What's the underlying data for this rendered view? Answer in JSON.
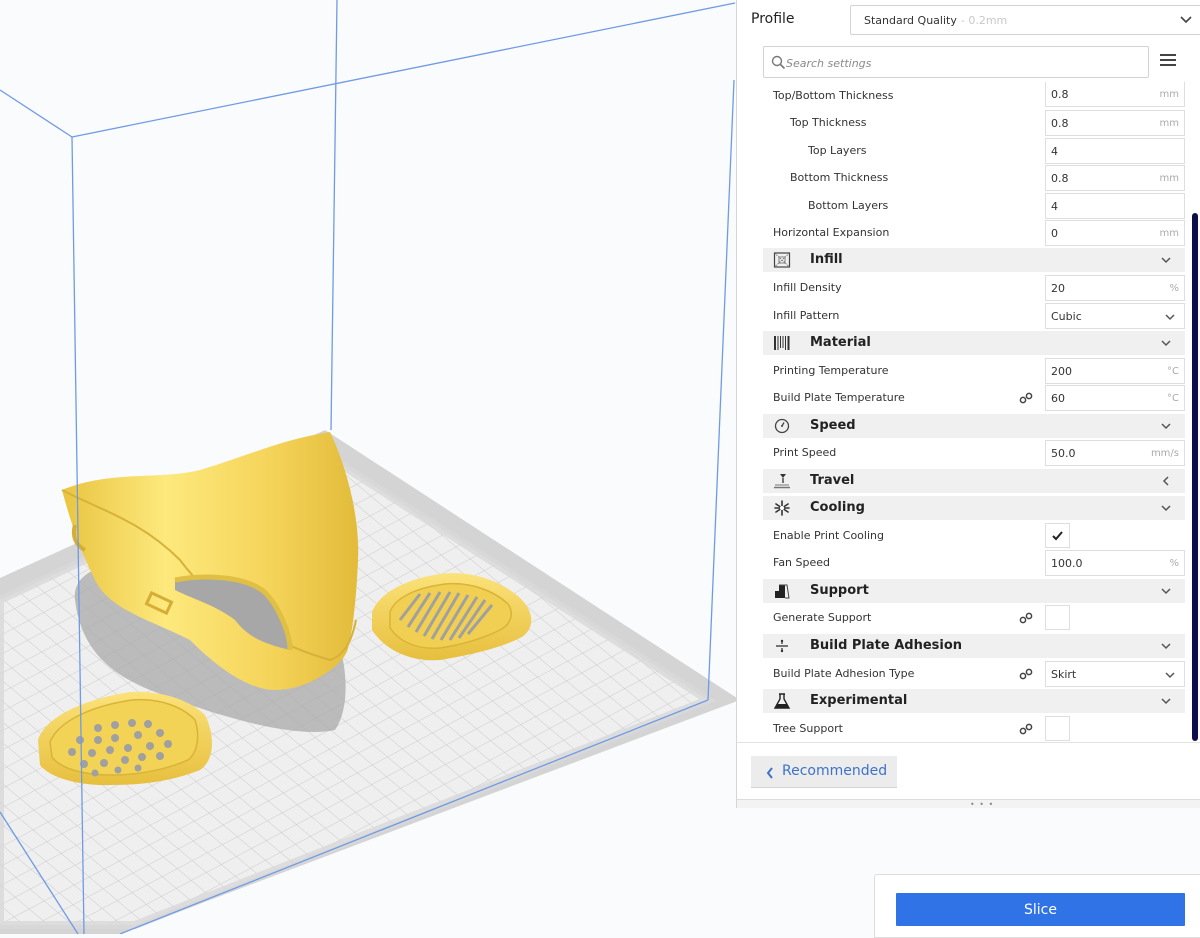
{
  "profile": {
    "label": "Profile",
    "value": "Standard Quality",
    "suffix": "- 0.2mm"
  },
  "search": {
    "placeholder": "Search settings"
  },
  "settings": {
    "top_bottom_thickness": {
      "label": "Top/Bottom Thickness",
      "value": "0.8",
      "unit": "mm"
    },
    "top_thickness": {
      "label": "Top Thickness",
      "value": "0.8",
      "unit": "mm"
    },
    "top_layers": {
      "label": "Top Layers",
      "value": "4"
    },
    "bottom_thickness": {
      "label": "Bottom Thickness",
      "value": "0.8",
      "unit": "mm"
    },
    "bottom_layers": {
      "label": "Bottom Layers",
      "value": "4"
    },
    "horizontal_expansion": {
      "label": "Horizontal Expansion",
      "value": "0",
      "unit": "mm"
    },
    "infill": {
      "title": "Infill",
      "icon": "infill-icon",
      "density": {
        "label": "Infill Density",
        "value": "20",
        "unit": "%"
      },
      "pattern": {
        "label": "Infill Pattern",
        "value": "Cubic"
      }
    },
    "material": {
      "title": "Material",
      "icon": "material-icon",
      "print_temp": {
        "label": "Printing Temperature",
        "value": "200",
        "unit": "°C"
      },
      "plate_temp": {
        "label": "Build Plate Temperature",
        "value": "60",
        "unit": "°C"
      }
    },
    "speed": {
      "title": "Speed",
      "icon": "speed-gauge-icon",
      "print_speed": {
        "label": "Print Speed",
        "value": "50.0",
        "unit": "mm/s"
      }
    },
    "travel": {
      "title": "Travel",
      "icon": "travel-icon",
      "collapsed": true
    },
    "cooling": {
      "title": "Cooling",
      "icon": "fan-icon",
      "enable": {
        "label": "Enable Print Cooling",
        "checked": true
      },
      "fan_speed": {
        "label": "Fan Speed",
        "value": "100.0",
        "unit": "%"
      }
    },
    "support": {
      "title": "Support",
      "icon": "support-icon",
      "generate": {
        "label": "Generate Support",
        "checked": false
      }
    },
    "adhesion": {
      "title": "Build Plate Adhesion",
      "icon": "adhesion-icon",
      "type": {
        "label": "Build Plate Adhesion Type",
        "value": "Skirt"
      }
    },
    "experimental": {
      "title": "Experimental",
      "icon": "flask-icon",
      "tree_support": {
        "label": "Tree Support",
        "checked": false
      }
    }
  },
  "footer": {
    "recommended_label": "Recommended",
    "grip": "• • •"
  },
  "slice": {
    "label": "Slice"
  },
  "colors": {
    "accent": "#2f73e6",
    "link": "#3e72c9",
    "scrollbar": "#0f0e4c",
    "model": "#f7d75a",
    "build_volume": "#6f9ae6"
  }
}
